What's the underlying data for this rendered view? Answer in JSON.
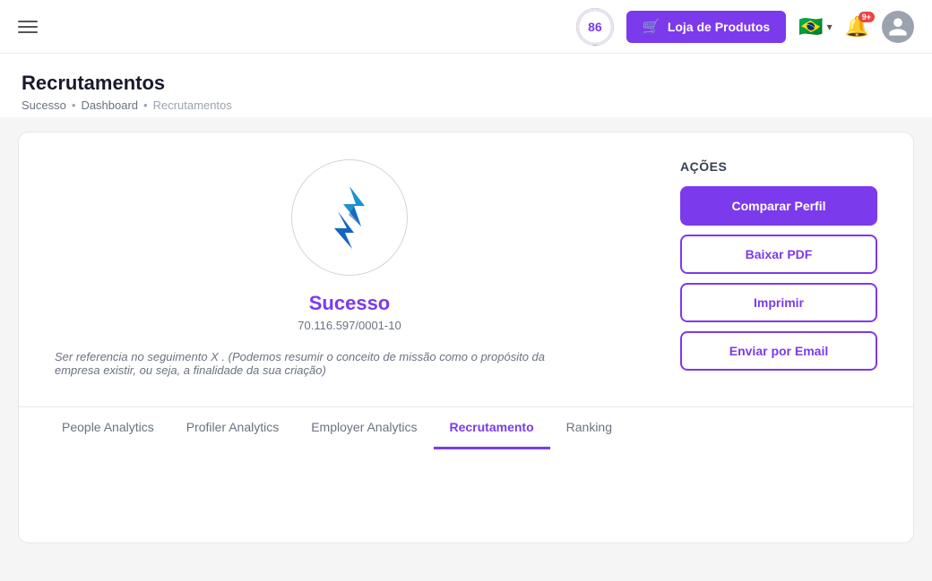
{
  "header": {
    "score": "86",
    "shop_button_label": "Loja de Produtos",
    "flag_emoji": "🇧🇷",
    "notification_badge": "9+",
    "score_aria": "Score 86"
  },
  "page": {
    "title": "Recrutamentos",
    "breadcrumb": [
      {
        "label": "Sucesso",
        "link": true
      },
      {
        "label": "Dashboard",
        "link": true
      },
      {
        "label": "Recrutamentos",
        "link": false
      }
    ]
  },
  "company": {
    "name": "Sucesso",
    "cnpj": "70.116.597/0001-10",
    "description": "Ser referencia no seguimento X . (Podemos resumir o conceito de missão como o propósito da empresa existir, ou seja, a finalidade da sua criação)"
  },
  "actions": {
    "title": "AÇÕES",
    "buttons": [
      {
        "label": "Comparar Perfil",
        "style": "primary"
      },
      {
        "label": "Baixar PDF",
        "style": "outline"
      },
      {
        "label": "Imprimir",
        "style": "outline"
      },
      {
        "label": "Enviar por Email",
        "style": "outline"
      }
    ]
  },
  "tabs": [
    {
      "label": "People Analytics",
      "active": false
    },
    {
      "label": "Profiler Analytics",
      "active": false
    },
    {
      "label": "Employer Analytics",
      "active": false
    },
    {
      "label": "Recrutamento",
      "active": true
    },
    {
      "label": "Ranking",
      "active": false
    }
  ]
}
